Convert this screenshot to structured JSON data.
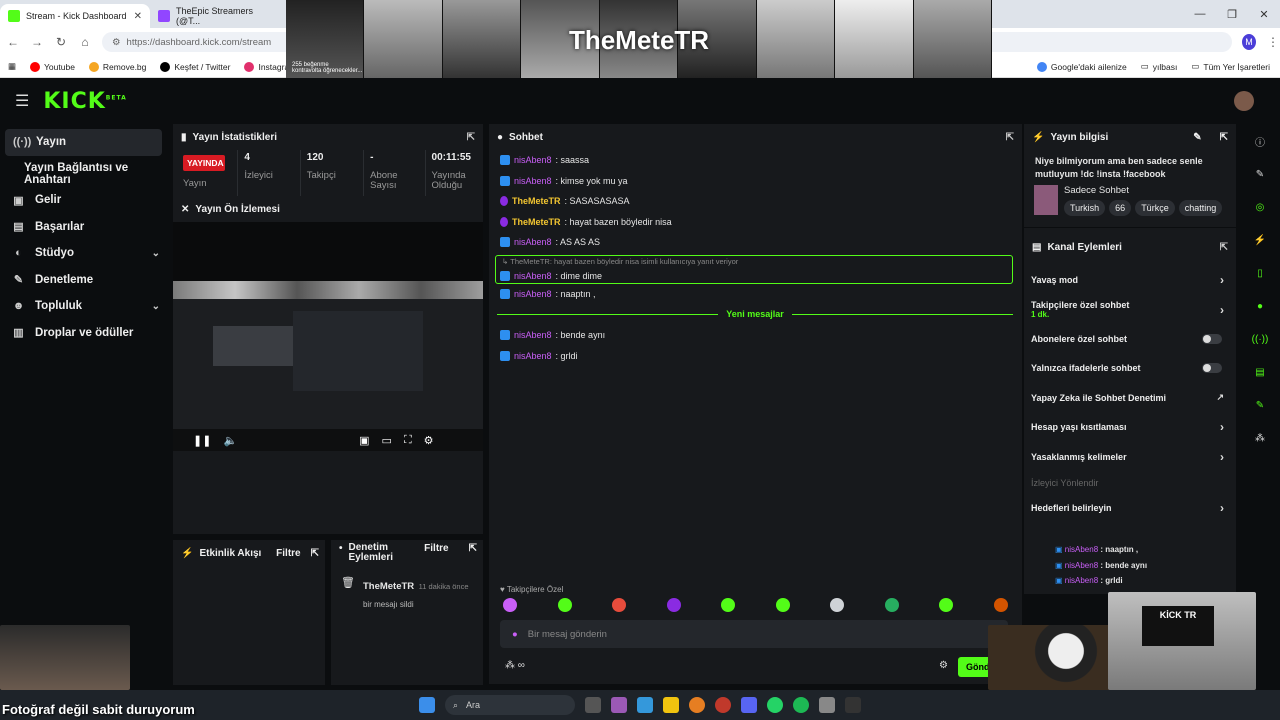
{
  "browser": {
    "tabs": [
      {
        "label": "Stream - Kick Dashboard",
        "active": true
      },
      {
        "label": "TheEpic Streamers (@T...",
        "active": false
      }
    ],
    "url": "https://dashboard.kick.com/stream",
    "profile_initial": "M",
    "bookmarks": [
      {
        "label": "Youtube",
        "color": "#ff0000"
      },
      {
        "label": "Remove.bg",
        "color": "#f5a623"
      },
      {
        "label": "Keşfet / Twitter",
        "color": "#000000"
      },
      {
        "label": "Instagram",
        "color": "#e1306c"
      }
    ],
    "bookmarks_right": [
      "Google'daki ailenize",
      "yılbası",
      "Tüm Yer İşaretleri"
    ]
  },
  "overlay": {
    "title": "TheMeteTR",
    "snippet": "255 beğenme",
    "snippet2": "kontravolta öğrenecekler..."
  },
  "app": {
    "logo": "KICK",
    "logo_sup": "BETA"
  },
  "sidebar": {
    "items": [
      {
        "label": "Yayın",
        "icon": "broadcast-icon"
      },
      {
        "label": "Yayın Bağlantısı ve Anahtarı",
        "icon": ""
      },
      {
        "label": "Gelir",
        "icon": "wallet-icon"
      },
      {
        "label": "Başarılar",
        "icon": "trophy-icon"
      },
      {
        "label": "Stüdyo",
        "icon": "studio-icon"
      },
      {
        "label": "Denetleme",
        "icon": "wrench-icon"
      },
      {
        "label": "Topluluk",
        "icon": "community-icon"
      },
      {
        "label": "Droplar ve ödüller",
        "icon": "gift-icon"
      }
    ]
  },
  "stats": {
    "title": "Yayın İstatistikleri",
    "live": "YAYINDA",
    "live_label": "Yayın",
    "viewers": "4",
    "viewers_label": "İzleyici",
    "followers": "120",
    "followers_label": "Takipçi",
    "subs": "-",
    "subs_label": "Abone Sayısı",
    "uptime": "00:11:55",
    "uptime_label": "Yayında Olduğu"
  },
  "preview": {
    "title": "Yayın Ön İzlemesi"
  },
  "activity": {
    "title": "Etkinlik Akışı",
    "filter": "Filtre"
  },
  "modactions": {
    "title": "Denetim Eylemleri",
    "filter": "Filtre",
    "entry_user": "TheMeteTR",
    "entry_time": "11 dakika önce",
    "entry_text": "bir mesajı sildi"
  },
  "chat": {
    "title": "Sohbet",
    "messages": [
      {
        "user": "nisAben8",
        "text": ": saassa",
        "role": "viewer"
      },
      {
        "user": "nisAben8",
        "text": ": kimse yok mu ya",
        "role": "viewer"
      },
      {
        "user": "TheMeteTR",
        "text": ": SASASASASA",
        "role": "host"
      },
      {
        "user": "TheMeteTR",
        "text": ": hayat bazen böyledir nisa",
        "role": "host"
      },
      {
        "user": "nisAben8",
        "text": ": AS AS AS",
        "role": "viewer"
      }
    ],
    "reply_context": "TheMeteTR: hayat bazen böyledir nisa isimli kullanıcıya yanıt veriyor",
    "reply_msg": {
      "user": "nisAben8",
      "text": ": dime dime"
    },
    "msg_after": {
      "user": "nisAben8",
      "text": ": naaptın ,"
    },
    "new_messages": "Yeni mesajlar",
    "new": [
      {
        "user": "nisAben8",
        "text": ": bende aynı"
      },
      {
        "user": "nisAben8",
        "text": ": grldi"
      }
    ],
    "followers_only": "Takipçilere Özel",
    "placeholder": "Bir mesaj gönderin",
    "send": "Gönder"
  },
  "streaminfo": {
    "title": "Yayın bilgisi",
    "desc": "Niye bilmiyorum ama ben sadece senle mutluyum !dc !insta !facebook",
    "category": "Sadece Sohbet",
    "tags": [
      "Turkish",
      "66",
      "Türkçe",
      "chatting"
    ]
  },
  "channel": {
    "title": "Kanal Eylemleri",
    "actions": [
      {
        "label": "Yavaş mod",
        "kind": "arrow"
      },
      {
        "label": "Takipçilere özel sohbet",
        "sub": "1 dk.",
        "kind": "arrow"
      },
      {
        "label": "Abonelere özel sohbet",
        "kind": "toggle"
      },
      {
        "label": "Yalnızca ifadelerle sohbet",
        "kind": "toggle"
      },
      {
        "label": "Yapay Zeka ile Sohbet Denetimi",
        "kind": "ext"
      },
      {
        "label": "Hesap yaşı kısıtlaması",
        "kind": "arrow"
      },
      {
        "label": "Yasaklanmış kelimeler",
        "kind": "arrow"
      }
    ],
    "disabled": "İzleyici Yönlendir",
    "goals": "Hedefleri belirleyin",
    "mini": [
      {
        "user": "nisAben8",
        "text": " : naaptın ,"
      },
      {
        "user": "nisAben8",
        "text": " : bende aynı"
      },
      {
        "user": "nisAben8",
        "text": " : grldi"
      }
    ]
  },
  "taskbar": {
    "search": "Ara"
  },
  "caption": "Fotoğraf değil sabit duruyorum",
  "cam_label": "KİCK TR"
}
